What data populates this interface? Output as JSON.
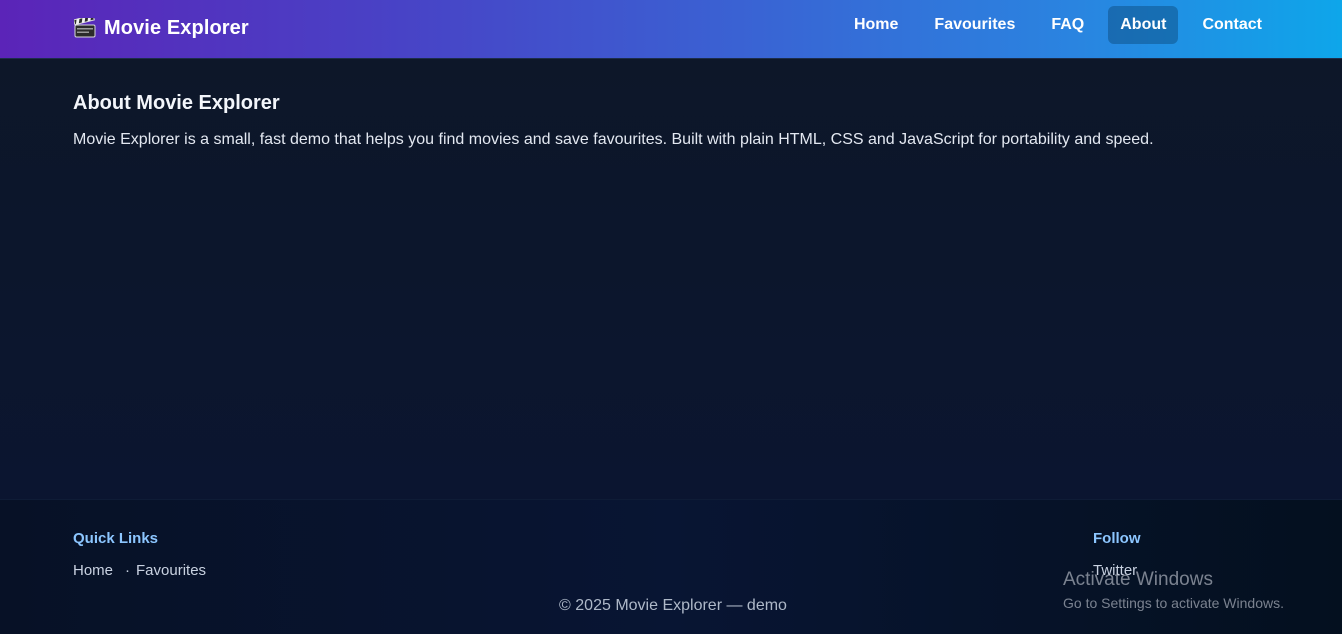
{
  "header": {
    "brand_icon": "clapperboard-icon",
    "brand_title": "Movie Explorer",
    "nav": [
      {
        "label": "Home"
      },
      {
        "label": "Favourites"
      },
      {
        "label": "FAQ"
      },
      {
        "label": "About",
        "active": true
      },
      {
        "label": "Contact"
      }
    ]
  },
  "main": {
    "title": "About Movie Explorer",
    "description": "Movie Explorer is a small, fast demo that helps you find movies and save favourites. Built with plain HTML, CSS and JavaScript for portability and speed."
  },
  "footer": {
    "quick_links_heading": "Quick Links",
    "quick_links": [
      {
        "label": "Home"
      },
      {
        "label": "Favourites"
      }
    ],
    "separator": "·",
    "follow_heading": "Follow",
    "follow_links": [
      {
        "label": "Twitter"
      }
    ],
    "copyright": "© 2025 Movie Explorer — demo"
  },
  "os_watermark": {
    "title": "Activate Windows",
    "subtitle": "Go to Settings to activate Windows."
  },
  "colors": {
    "header_gradient_start": "#5b24b8",
    "header_gradient_end": "#0ea6ea",
    "background": "#0c1628",
    "footer_heading": "#8cc6ff"
  }
}
